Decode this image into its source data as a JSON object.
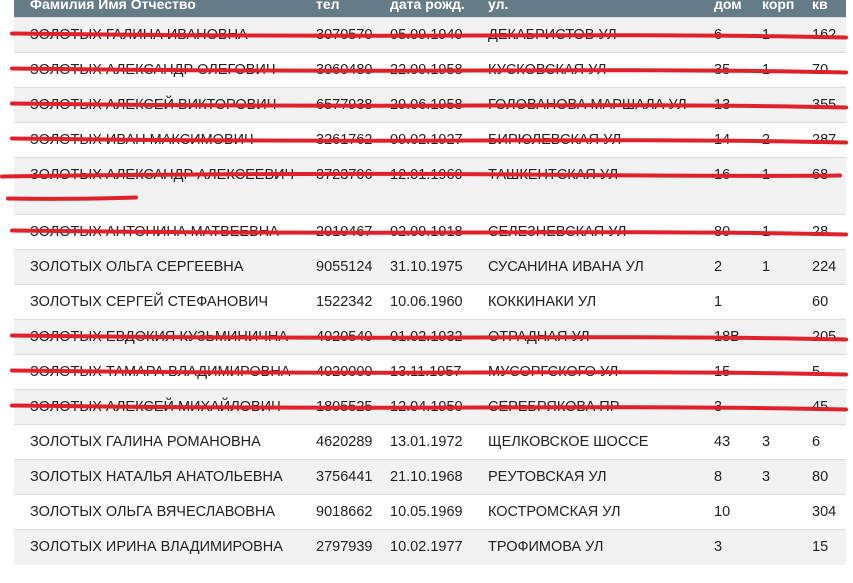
{
  "headers": {
    "name": "Фамилия Имя Отчество",
    "tel": "тел",
    "dob": "дата рожд.",
    "street": "ул.",
    "house": "дом",
    "corp": "корп",
    "apt": "кв"
  },
  "rows": [
    {
      "name": "ЗОЛОТЫХ ГАЛИНА ИВАНОВНА",
      "tel": "3070570",
      "dob": "05.09.1940",
      "street": "ДЕКАБРИСТОВ УЛ",
      "house": "6",
      "corp": "1",
      "apt": "162",
      "struck": true
    },
    {
      "name": "ЗОЛОТЫХ АЛЕКСАНДР ОЛЕГОВИЧ",
      "tel": "3060480",
      "dob": "22.09.1958",
      "street": "КУСКОВСКАЯ УЛ",
      "house": "35",
      "corp": "1",
      "apt": "70",
      "struck": true
    },
    {
      "name": "ЗОЛОТЫХ АЛЕКСЕЙ ВИКТОРОВИЧ",
      "tel": "6577938",
      "dob": "29.06.1958",
      "street": "ГОЛОВАНОВА МАРШАЛА УЛ",
      "house": "13",
      "corp": "",
      "apt": "355",
      "struck": true
    },
    {
      "name": "ЗОЛОТЫХ ИВАН МАКСИМОВИЧ",
      "tel": "3261762",
      "dob": "09.02.1927",
      "street": "БИРЮЛЕВСКАЯ УЛ",
      "house": "14",
      "corp": "2",
      "apt": "287",
      "struck": true
    },
    {
      "name": "ЗОЛОТЫХ АЛЕКСАНДР АЛЕКСЕЕВИЧ",
      "tel": "3723706",
      "dob": "12.01.1960",
      "street": "ТАШКЕНТСКАЯ УЛ",
      "house": "16",
      "corp": "1",
      "apt": "68",
      "struck": true,
      "tall": true
    },
    {
      "name": "ЗОЛОТЫХ АНТОНИНА МАТВЕЕВНА",
      "tel": "2010467",
      "dob": "02.09.1918",
      "street": "СЕЛЕЗНЕВСКАЯ УЛ",
      "house": "80",
      "corp": "1",
      "apt": "28",
      "struck": true
    },
    {
      "name": "ЗОЛОТЫХ ОЛЬГА СЕРГЕЕВНА",
      "tel": "9055124",
      "dob": "31.10.1975",
      "street": "СУСАНИНА ИВАНА УЛ",
      "house": "2",
      "corp": "1",
      "apt": "224",
      "struck": false
    },
    {
      "name": "ЗОЛОТЫХ СЕРГЕЙ СТЕФАНОВИЧ",
      "tel": "1522342",
      "dob": "10.06.1960",
      "street": "КОККИНАКИ УЛ",
      "house": "1",
      "corp": "",
      "apt": "60",
      "struck": false
    },
    {
      "name": "ЗОЛОТЫХ ЕВДОКИЯ КУЗЬМИНИЧНА",
      "tel": "4020540",
      "dob": "01.02.1932",
      "street": "ОТРАДНАЯ УЛ",
      "house": "18В",
      "corp": "",
      "apt": "205",
      "struck": true
    },
    {
      "name": "ЗОЛОТЫХ ТАМАРА ВЛАДИМИРОВНА",
      "tel": "4020000",
      "dob": "13.11.1957",
      "street": "МУСОРГСКОГО УЛ",
      "house": "15",
      "corp": "",
      "apt": "5",
      "struck": true
    },
    {
      "name": "ЗОЛОТЫХ АЛЕКСЕЙ МИХАЙЛОВИЧ",
      "tel": "1805525",
      "dob": "12.04.1950",
      "street": "СЕРЕБРЯКОВА ПР",
      "house": "3",
      "corp": "",
      "apt": "45",
      "struck": true
    },
    {
      "name": "ЗОЛОТЫХ ГАЛИНА РОМАНОВНА",
      "tel": "4620289",
      "dob": "13.01.1972",
      "street": "ЩЕЛКОВСКОЕ ШОССЕ",
      "house": "43",
      "corp": "3",
      "apt": "6",
      "struck": false
    },
    {
      "name": "ЗОЛОТЫХ НАТАЛЬЯ АНАТОЛЬЕВНА",
      "tel": "3756441",
      "dob": "21.10.1968",
      "street": "РЕУТОВСКАЯ УЛ",
      "house": "8",
      "corp": "3",
      "apt": "80",
      "struck": false
    },
    {
      "name": "ЗОЛОТЫХ ОЛЬГА ВЯЧЕСЛАВОВНА",
      "tel": "9018662",
      "dob": "10.05.1969",
      "street": "КОСТРОМСКАЯ УЛ",
      "house": "10",
      "corp": "",
      "apt": "304",
      "struck": false
    },
    {
      "name": "ЗОЛОТЫХ ИРИНА ВЛАДИМИРОВНА",
      "tel": "2797939",
      "dob": "10.02.1977",
      "street": "ТРОФИМОВА УЛ",
      "house": "3",
      "corp": "",
      "apt": "15",
      "struck": false
    }
  ]
}
